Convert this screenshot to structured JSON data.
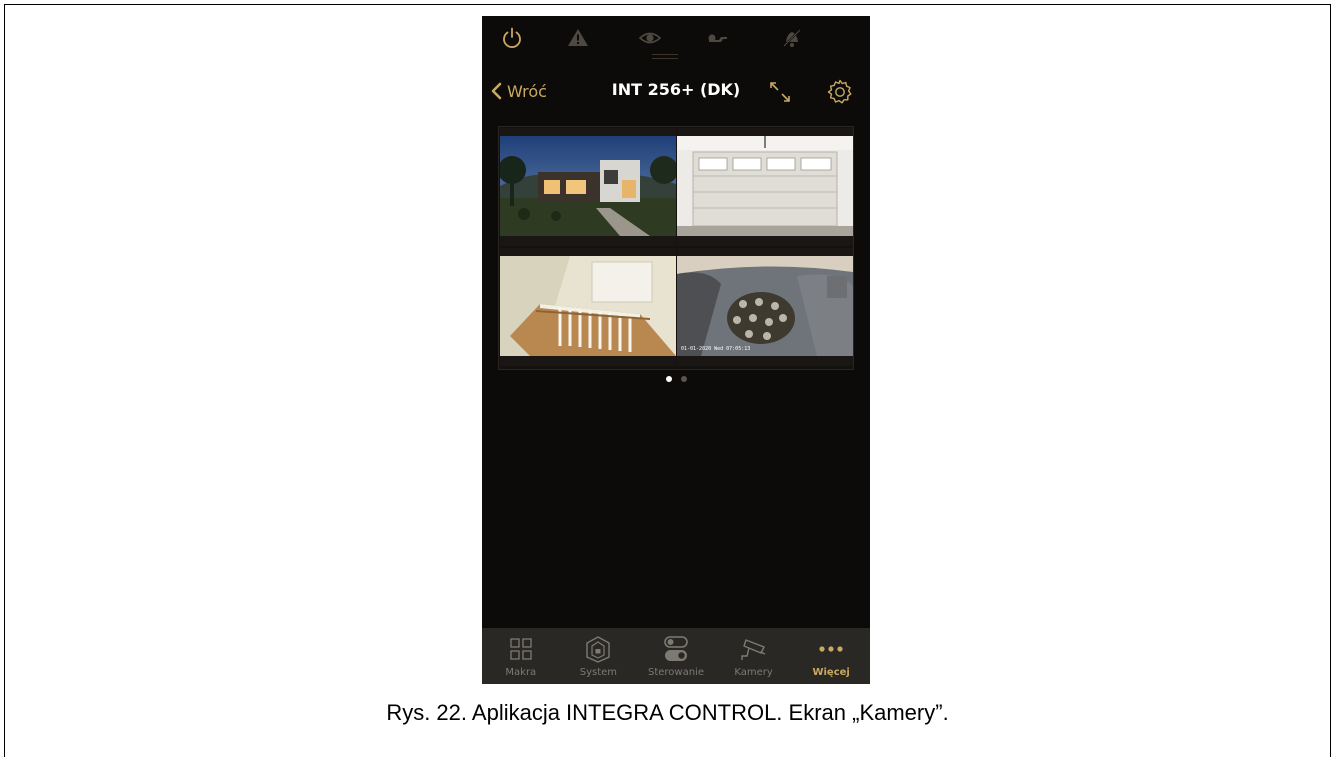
{
  "header": {
    "back_label": "Wróć",
    "title": "INT 256+ (DK)"
  },
  "top_icons": [
    "power-icon",
    "alert-triangle-icon",
    "eye-icon",
    "wrench-icon",
    "bell-off-icon"
  ],
  "header_icons": [
    "chevron-left-icon",
    "expand-icon",
    "gear-icon"
  ],
  "cameras": [
    {
      "scene": "modern house at dusk"
    },
    {
      "scene": "garage door interior"
    },
    {
      "scene": "staircase with white railing"
    },
    {
      "scene": "courtyard fisheye view",
      "overlay_text": "01-01-2020 Wed 07:05:13"
    }
  ],
  "pager": {
    "pages": 2,
    "current": 1
  },
  "tabs": [
    {
      "label": "Makra",
      "icon": "grid-icon",
      "active": false
    },
    {
      "label": "System",
      "icon": "house-shield-icon",
      "active": false
    },
    {
      "label": "Sterowanie",
      "icon": "toggle-icon",
      "active": false
    },
    {
      "label": "Kamery",
      "icon": "camera-icon",
      "active": false
    },
    {
      "label": "Więcej",
      "icon": "more-icon",
      "active": true
    }
  ],
  "caption": "Rys. 22. Aplikacja INTEGRA CONTROL. Ekran „Kamery”.",
  "colors": {
    "accent": "#c9a961",
    "background": "#0d0b09",
    "tabbar": "#2a2825",
    "inactive_icon": "#4d4840"
  }
}
